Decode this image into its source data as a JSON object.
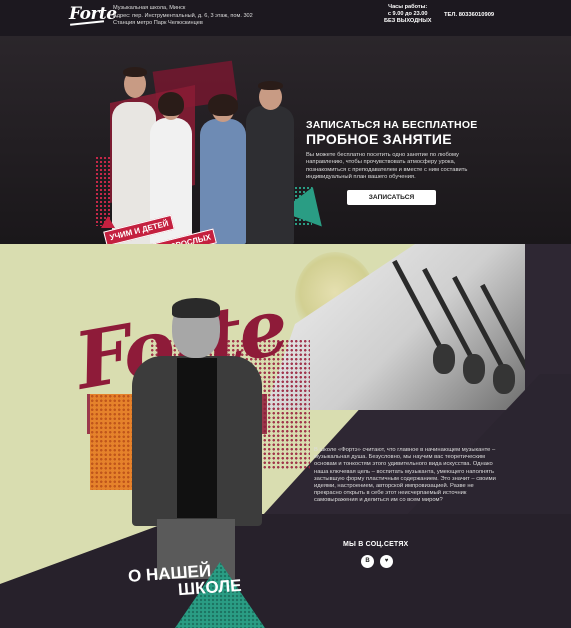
{
  "header": {
    "logo": "Forte",
    "address_lines": [
      "Музыкальная школа, Минск",
      "Адрес: пер. Инструментальный, д. 6, 3 этаж, пом. 302",
      "Станция метро Парк Челюскинцев"
    ],
    "hours_lines": [
      "Часы работы:",
      "с 9.00 до 23.00",
      "БЕЗ ВЫХОДНЫХ"
    ],
    "phone": "ТЕЛ. 80336010909"
  },
  "hero": {
    "title_line1": "ЗАПИСАТЬСЯ НА БЕСПЛАТНОЕ",
    "title_line2": "ПРОБНОЕ ЗАНЯТИЕ",
    "text": "Вы можете бесплатно посетить одно занятие по любому направлению, чтобы прочувствовать атмосферу урока, познакомиться с преподавателем и вместе с ним составить индивидуальный план вашего обучения.",
    "button": "ЗАПИСАТЬСЯ",
    "badge_line1": "УЧИМ И ДЕТЕЙ",
    "badge_line2": "И ВЗРОСЛЫХ"
  },
  "about": {
    "watermark": "Forte",
    "text": "В школе «Фортэ» считают, что главное в начинающем музыканте – музыкальная душа. Безусловно, мы научим вас теоретическим основам и тонкостям этого удивительного вида искусства. Однако наша ключевая цель – воспитать музыканта, умеющего наполнять застывшую форму пластичным содержанием. Это значит – своими идеями, настроением, авторской импровизацией. Разве не прекрасно открыть в себе этот неисчерпаемый источник самовыражения и делиться им со всем миром?",
    "social_title": "МЫ В СОЦ.СЕТЯХ",
    "social_icons": [
      "В",
      "♥"
    ],
    "heading_line1": "О НАШЕЙ",
    "heading_line2": "ШКОЛЕ"
  },
  "colors": {
    "accent_red": "#c4203f",
    "wine": "#8e1b39",
    "teal": "#2a9d84",
    "orange": "#e5822b",
    "cream": "#d9ddb0"
  }
}
